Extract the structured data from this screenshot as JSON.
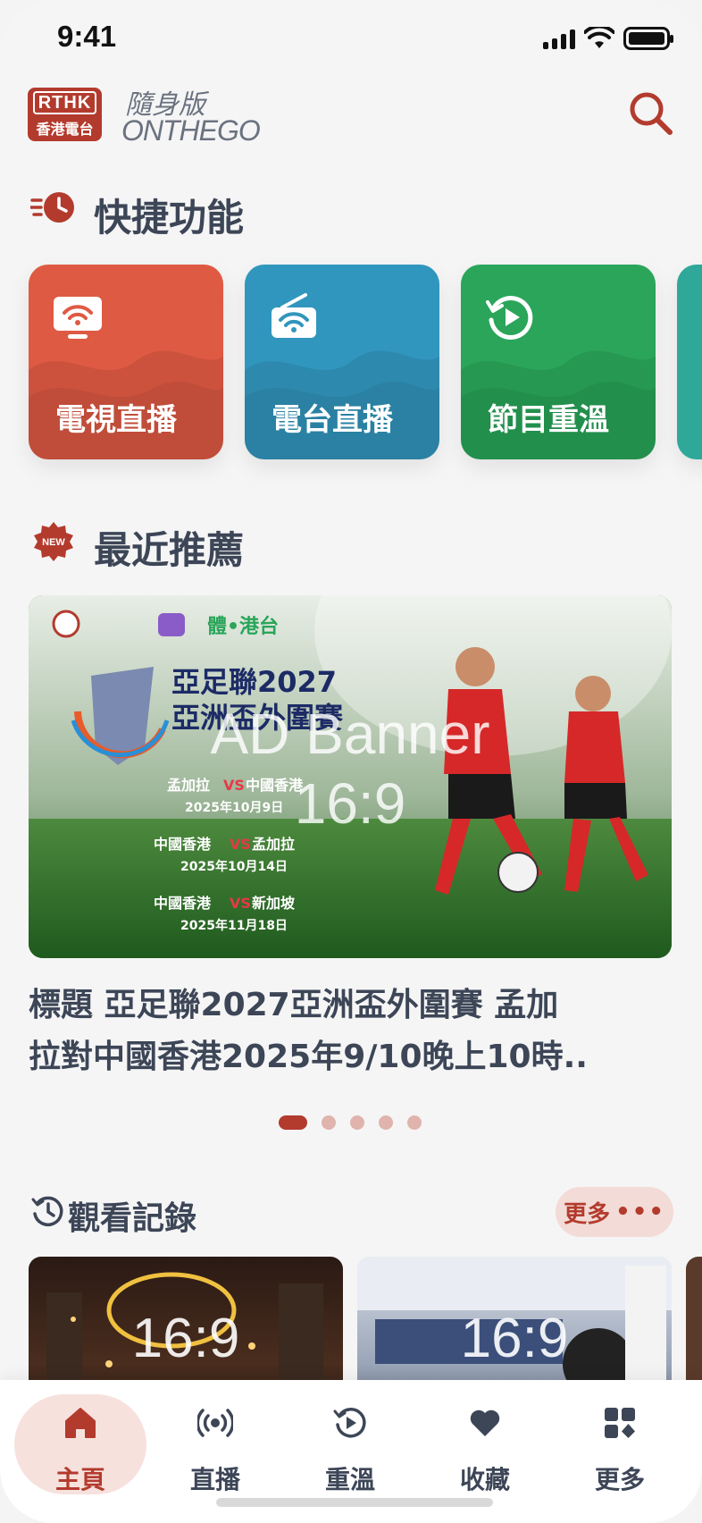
{
  "status": {
    "time": "9:41"
  },
  "header": {
    "logo_top": "RTHK",
    "logo_bottom": "香港電台",
    "brand_cn": "隨身版",
    "brand_en": "ONTHEGO"
  },
  "quick": {
    "title": "快捷功能",
    "tiles": [
      {
        "label": "電視直播",
        "icon": "tv-icon",
        "color": "#df5a43"
      },
      {
        "label": "電台直播",
        "icon": "radio-icon",
        "color": "#3196bd"
      },
      {
        "label": "節目重溫",
        "icon": "replay-icon",
        "color": "#2aa55a"
      }
    ]
  },
  "recommend": {
    "title": "最近推薦",
    "badge": "NEW",
    "banner_overlay_line1": "AD Banner",
    "banner_overlay_line2": "16:9",
    "banner_title": "亞足聯2027",
    "banner_subtitle": "亞洲盃外圍賽",
    "matches": [
      {
        "home": "孟加拉",
        "away": "中國香港",
        "date": "2025年10月9日"
      },
      {
        "home": "中國香港",
        "away": "孟加拉",
        "date": "2025年10月14日"
      },
      {
        "home": "中國香港",
        "away": "新加坡",
        "date": "2025年11月18日"
      }
    ],
    "caption_line1": "標題 亞足聯2027亞洲盃外圍賽 孟加",
    "caption_line2": "拉對中國香港2025年9/10晚上10時..",
    "dots_count": 5,
    "active_dot": 0
  },
  "history": {
    "title": "觀看記錄",
    "more_label": "更多",
    "thumbs": [
      {
        "ratio": "16:9"
      },
      {
        "ratio": "16:9"
      }
    ]
  },
  "tabbar": {
    "tabs": [
      {
        "label": "主頁",
        "icon": "home-icon",
        "active": true
      },
      {
        "label": "直播",
        "icon": "broadcast-icon",
        "active": false
      },
      {
        "label": "重溫",
        "icon": "replay-icon",
        "active": false
      },
      {
        "label": "收藏",
        "icon": "heart-icon",
        "active": false
      },
      {
        "label": "更多",
        "icon": "grid-icon",
        "active": false
      }
    ]
  },
  "colors": {
    "accent": "#b33b2e",
    "text": "#3d4657"
  }
}
